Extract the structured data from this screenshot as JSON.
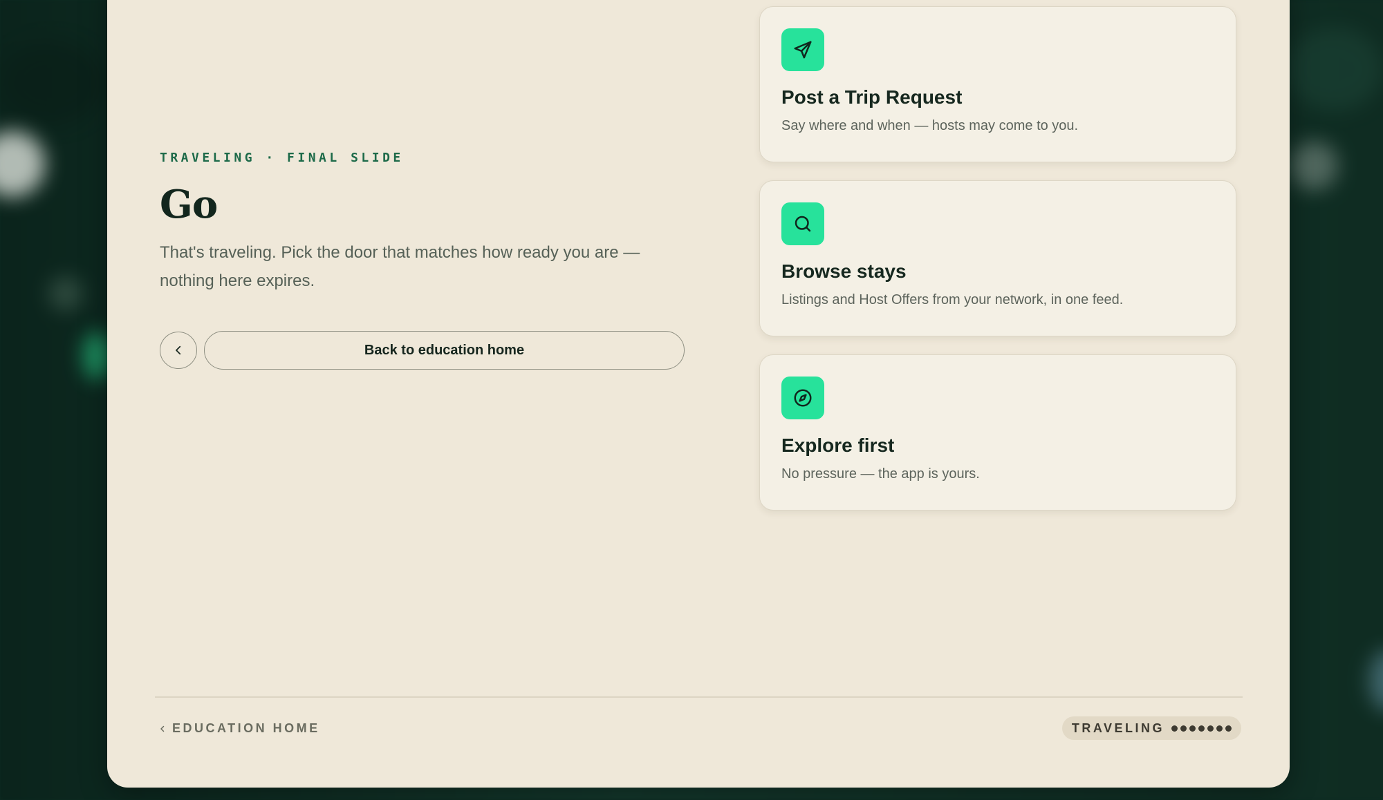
{
  "slide": {
    "eyebrow": "TRAVELING · FINAL SLIDE",
    "title": "Go",
    "lead": "That's traveling. Pick the door that matches how ready you are — nothing here expires.",
    "back_button_label": "Back to education home"
  },
  "cards": [
    {
      "icon": "send-icon",
      "title": "Post a Trip Request",
      "desc": "Say where and when — hosts may come to you."
    },
    {
      "icon": "search-icon",
      "title": "Browse stays",
      "desc": "Listings and Host Offers from your network, in one feed."
    },
    {
      "icon": "compass-icon",
      "title": "Explore first",
      "desc": "No pressure — the app is yours."
    }
  ],
  "footer": {
    "home_link": "EDUCATION HOME",
    "section": "TRAVELING",
    "progress_total": 7
  },
  "colors": {
    "panel": "#efe8d9",
    "accent": "#27e29b",
    "eyebrow": "#1d6a49"
  }
}
